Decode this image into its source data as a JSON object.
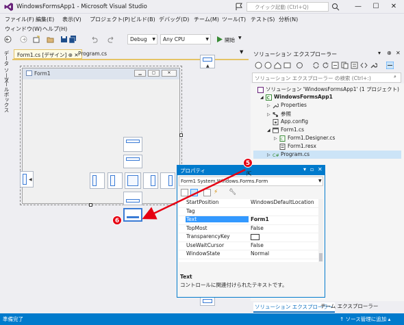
{
  "window": {
    "title": "WindowsFormsApp1 - Microsoft Visual Studio",
    "quick_launch_placeholder": "クイック起動 (Ctrl+Q)",
    "min": "—",
    "max": "☐",
    "close": "✕"
  },
  "menu": [
    "ファイル(F)",
    "編集(E)",
    "表示(V)",
    "プロジェクト(P)",
    "ビルド(B)",
    "デバッグ(D)",
    "チーム(M)",
    "ツール(T)",
    "テスト(S)",
    "分析(N)",
    "ウィンドウ(W)",
    "ヘルプ(H)"
  ],
  "toolbar": {
    "config": "Debug",
    "platform": "Any CPU",
    "start_label": "開始"
  },
  "left_rail": {
    "datasource": "データ ソース",
    "toolbox": "ツールボックス"
  },
  "doc_tabs": {
    "form1": "Form1.cs [デザイン]",
    "program": "Program.cs"
  },
  "designer": {
    "form_caption": "Form1"
  },
  "solution": {
    "title": "ソリューション エクスプローラー",
    "search_placeholder": "ソリューション エクスプローラー の検索 (Ctrl+:)",
    "tree": [
      {
        "label": "ソリューション 'WindowsFormsApp1' (1 プロジェクト)"
      },
      {
        "label": "WindowsFormsApp1"
      },
      {
        "label": "Properties"
      },
      {
        "label": "参照"
      },
      {
        "label": "App.config"
      },
      {
        "label": "Form1.cs"
      },
      {
        "label": "Form1.Designer.cs"
      },
      {
        "label": "Form1.resx"
      },
      {
        "label": "Program.cs"
      }
    ],
    "bottom_tabs": {
      "solution": "ソリューション エクスプローラー",
      "team": "チーム エクスプローラー"
    }
  },
  "properties": {
    "title": "プロパティ",
    "object": "Form1  System.Windows.Forms.Form",
    "rows": [
      {
        "name": "StartPosition",
        "value": "WindowsDefaultLocation"
      },
      {
        "name": "Tag",
        "value": ""
      },
      {
        "name": "Text",
        "value": "Form1"
      },
      {
        "name": "TopMost",
        "value": "False"
      },
      {
        "name": "TransparencyKey",
        "value": ""
      },
      {
        "name": "UseWaitCursor",
        "value": "False"
      },
      {
        "name": "WindowState",
        "value": "Normal"
      }
    ],
    "desc_title": "Text",
    "desc_text": "コントロールに関連付けられたテキストです。"
  },
  "annotations": {
    "five": "5",
    "six": "6"
  },
  "status": {
    "left": "準備完了",
    "right": "↑ ソース管理に追加 ▴"
  },
  "colors": {
    "accent": "#007acc",
    "badge": "#e60012",
    "selection": "#3399ff"
  }
}
